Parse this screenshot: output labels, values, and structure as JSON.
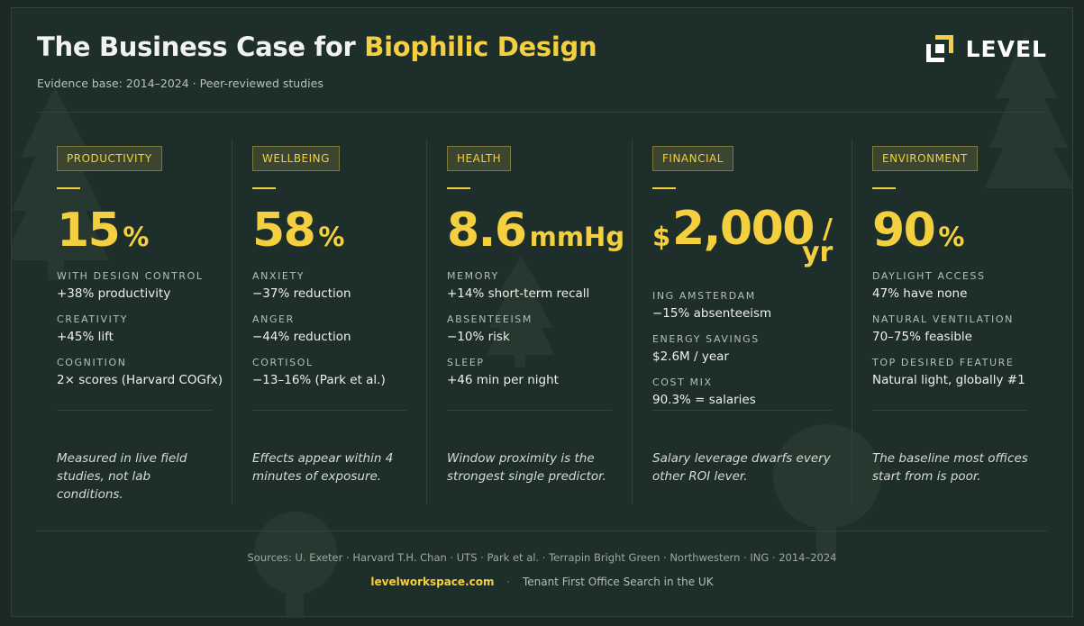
{
  "header": {
    "title_prefix": "The Business Case for",
    "title_accent": "Biophilic Design",
    "subtitle": "Evidence base: 2014–2024 · Peer-reviewed studies"
  },
  "logo": {
    "text": "LEVEL",
    "icon": "level-logo-icon"
  },
  "colors": {
    "background": "#1e2e2a",
    "accent": "#f4cf3f",
    "badge_bg": "#3b4530",
    "rule": "#2f423c"
  },
  "columns": [
    {
      "badge": "PRODUCTIVITY",
      "big_prefix": "",
      "big_number": "15",
      "big_unit": "%",
      "stats": [
        {
          "label": "WITH DESIGN CONTROL",
          "value": "+38% productivity"
        },
        {
          "label": "CREATIVITY",
          "value": "+45% lift"
        },
        {
          "label": "COGNITION",
          "value": "2× scores (Harvard COGfx)"
        }
      ],
      "note": "Measured in live field studies, not lab conditions."
    },
    {
      "badge": "WELLBEING",
      "big_prefix": "",
      "big_number": "58",
      "big_unit": "%",
      "stats": [
        {
          "label": "ANXIETY",
          "value": "−37% reduction"
        },
        {
          "label": "ANGER",
          "value": "−44% reduction"
        },
        {
          "label": "CORTISOL",
          "value": "−13–16% (Park et al.)"
        }
      ],
      "note": "Effects appear within 4 minutes of exposure."
    },
    {
      "badge": "HEALTH",
      "big_prefix": "",
      "big_number": "8.6",
      "big_unit": "mmHg",
      "stats": [
        {
          "label": "MEMORY",
          "value": "+14% short-term recall"
        },
        {
          "label": "ABSENTEEISM",
          "value": "−10% risk"
        },
        {
          "label": "SLEEP",
          "value": "+46 min per night"
        }
      ],
      "note": "Window proximity is the strongest single predictor."
    },
    {
      "badge": "FINANCIAL",
      "big_prefix": "$",
      "big_number": "2,000",
      "big_unit": "/ yr",
      "stats": [
        {
          "label": "ING AMSTERDAM",
          "value": "−15% absenteeism"
        },
        {
          "label": "ENERGY SAVINGS",
          "value": "$2.6M / year"
        },
        {
          "label": "COST MIX",
          "value": "90.3% = salaries"
        }
      ],
      "note": "Salary leverage dwarfs every other ROI lever."
    },
    {
      "badge": "ENVIRONMENT",
      "big_prefix": "",
      "big_number": "90",
      "big_unit": "%",
      "stats": [
        {
          "label": "DAYLIGHT ACCESS",
          "value": "47% have none"
        },
        {
          "label": "NATURAL VENTILATION",
          "value": "70–75% feasible"
        },
        {
          "label": "TOP DESIRED FEATURE",
          "value": "Natural light, globally #1"
        }
      ],
      "note": "The baseline most offices start from is poor."
    }
  ],
  "footer": {
    "sources": "Sources: U. Exeter · Harvard T.H. Chan · UTS · Park et al. · Terrapin Bright Green · Northwestern · ING · 2014–2024",
    "site": "levelworkspace.com",
    "separator": "·",
    "tagline": "Tenant First Office Search in the UK"
  }
}
